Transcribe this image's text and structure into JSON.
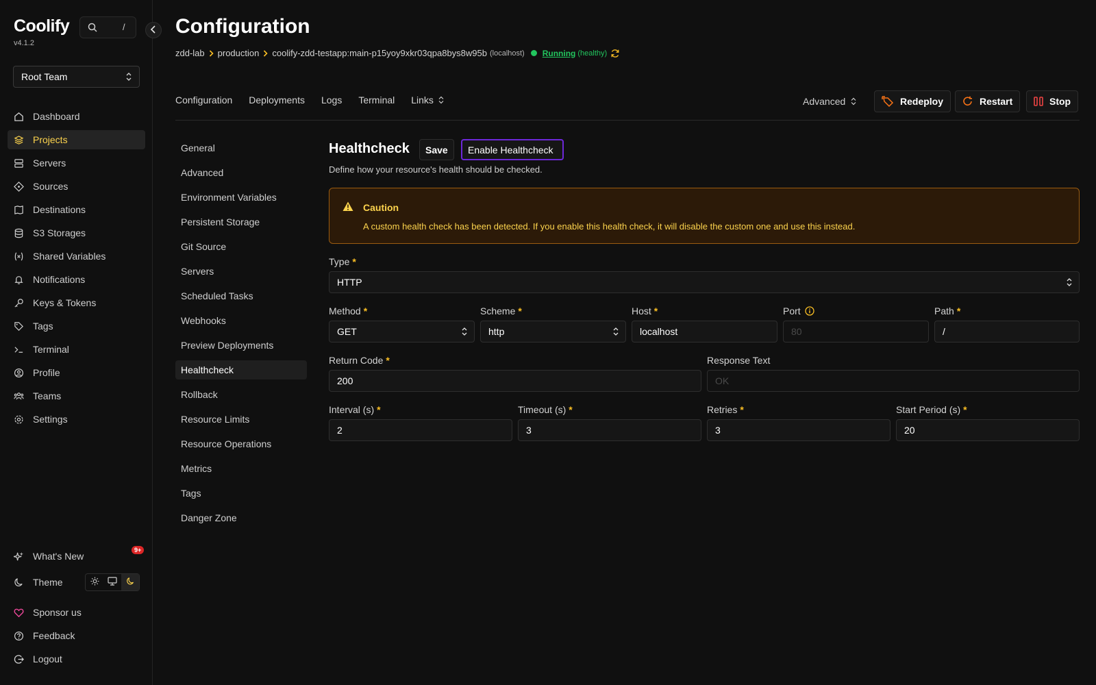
{
  "app": {
    "name": "Coolify",
    "version": "v4.1.2"
  },
  "search": {
    "shortcut": "/"
  },
  "team": {
    "selected": "Root Team"
  },
  "nav": [
    {
      "label": "Dashboard",
      "icon": "home-icon"
    },
    {
      "label": "Projects",
      "icon": "layers-icon",
      "active": true
    },
    {
      "label": "Servers",
      "icon": "server-icon"
    },
    {
      "label": "Sources",
      "icon": "git-icon"
    },
    {
      "label": "Destinations",
      "icon": "destination-icon"
    },
    {
      "label": "S3 Storages",
      "icon": "database-icon"
    },
    {
      "label": "Shared Variables",
      "icon": "variable-icon"
    },
    {
      "label": "Notifications",
      "icon": "bell-icon"
    },
    {
      "label": "Keys & Tokens",
      "icon": "key-icon"
    },
    {
      "label": "Tags",
      "icon": "tag-icon"
    },
    {
      "label": "Terminal",
      "icon": "terminal-icon"
    },
    {
      "label": "Profile",
      "icon": "user-icon"
    },
    {
      "label": "Teams",
      "icon": "users-icon"
    },
    {
      "label": "Settings",
      "icon": "gear-icon"
    }
  ],
  "nav_bottom": {
    "whats_new": "What's New",
    "whats_new_badge": "9+",
    "theme": "Theme",
    "sponsor": "Sponsor us",
    "feedback": "Feedback",
    "logout": "Logout"
  },
  "header": {
    "title": "Configuration",
    "breadcrumb": [
      "zdd-lab",
      "production",
      "coolify-zdd-testapp:main-p15yoy9xkr03qpa8bys8w95b"
    ],
    "breadcrumb_host": "(localhost)",
    "status": "Running",
    "health": "(healthy)"
  },
  "tabs": [
    "Configuration",
    "Deployments",
    "Logs",
    "Terminal",
    "Links"
  ],
  "actions": {
    "advanced": "Advanced",
    "redeploy": "Redeploy",
    "restart": "Restart",
    "stop": "Stop"
  },
  "submenu": [
    "General",
    "Advanced",
    "Environment Variables",
    "Persistent Storage",
    "Git Source",
    "Servers",
    "Scheduled Tasks",
    "Webhooks",
    "Preview Deployments",
    "Healthcheck",
    "Rollback",
    "Resource Limits",
    "Resource Operations",
    "Metrics",
    "Tags",
    "Danger Zone"
  ],
  "submenu_active": "Healthcheck",
  "healthcheck": {
    "title": "Healthcheck",
    "save": "Save",
    "enable": "Enable Healthcheck",
    "description": "Define how your resource's health should be checked.",
    "caution_title": "Caution",
    "caution_text": "A custom health check has been detected. If you enable this health check, it will disable the custom one and use this instead.",
    "type_label": "Type",
    "type_value": "HTTP",
    "method_label": "Method",
    "method_value": "GET",
    "scheme_label": "Scheme",
    "scheme_value": "http",
    "host_label": "Host",
    "host_value": "localhost",
    "port_label": "Port",
    "port_placeholder": "80",
    "path_label": "Path",
    "path_value": "/",
    "return_code_label": "Return Code",
    "return_code_value": "200",
    "response_text_label": "Response Text",
    "response_text_placeholder": "OK",
    "interval_label": "Interval (s)",
    "interval_value": "2",
    "timeout_label": "Timeout (s)",
    "timeout_value": "3",
    "retries_label": "Retries",
    "retries_value": "3",
    "start_period_label": "Start Period (s)",
    "start_period_value": "20",
    "required_mark": "*"
  },
  "colors": {
    "accent": "#fcd34d",
    "running": "#22c55e",
    "danger": "#dc2626",
    "purple": "#6d28d9"
  }
}
